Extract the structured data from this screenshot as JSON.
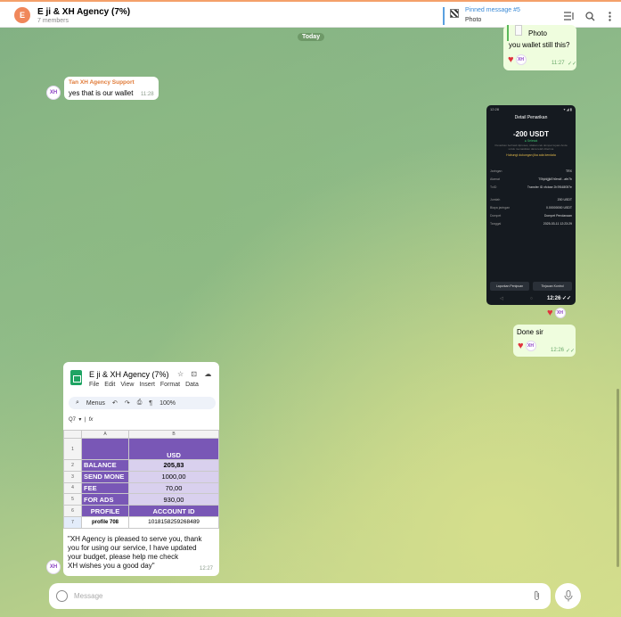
{
  "header": {
    "avatar_letter": "E",
    "title": "E ji & XH Agency (7%)",
    "members": "7 members",
    "pinned_title": "Pinned message #5",
    "pinned_sub": "Photo"
  },
  "chat": {
    "date_chip": "Today",
    "out_photo": {
      "caption_top": "Photo",
      "text": "you wallet still this?",
      "time": "11:27"
    },
    "in_reply": {
      "sender": "Tan XH Agency Support",
      "text": "yes that is our wallet",
      "time": "11:28"
    },
    "phone": {
      "status_left": "12:28",
      "status_right": "▾ ◢ ▮",
      "title": "Detail Penarikan",
      "amount": "-200 USDT",
      "status_ok": "● Selesai",
      "note": "Penarikan berhasil diproses, silakan cek dompet tujuan Anda untuk memastikan dana telah diterima",
      "link": "Hubungi dukungan jika ada kendala",
      "rows": [
        {
          "k": "Jaringan",
          "v": "TRX"
        },
        {
          "k": "Alamat",
          "v": "TSfyfdjjjkEh9mdf...afe7b"
        },
        {
          "k": "TxID",
          "v": "Transfer ID xfcbae 2b7f648f3f7e"
        },
        {
          "k": "Jumlah",
          "v": "200 USDT"
        },
        {
          "k": "Biaya jaringan",
          "v": "0.00000000 USDT"
        },
        {
          "k": "Dompet",
          "v": "Dompet Pendanaan"
        },
        {
          "k": "Tanggal",
          "v": "2025-03-11 12:23:29"
        }
      ],
      "btn_left": "Laporkan Penipuan",
      "btn_right": "Tinjauan Kontrol",
      "time": "12:26",
      "nav": [
        "◁",
        "○",
        "□"
      ]
    },
    "done": {
      "text": "Done sir",
      "time": "12:26"
    },
    "sheet": {
      "title": "E ji & XH Agency (7%)",
      "toolbar_icons": "☆ ⊡ ☁",
      "menu": [
        "File",
        "Edit",
        "View",
        "Insert",
        "Format",
        "Data"
      ],
      "tools_label": "Menus",
      "zoom": "100%",
      "cell_ref": "Q7",
      "fx": "fx",
      "col_headers": [
        "A",
        "B"
      ],
      "rows": [
        {
          "n": "1",
          "a": "",
          "b": "USD"
        },
        {
          "n": "2",
          "a": "BALANCE",
          "b": "205,83"
        },
        {
          "n": "3",
          "a": "SEND MONE",
          "b": "1000,00"
        },
        {
          "n": "4",
          "a": "FEE",
          "b": "70,00"
        },
        {
          "n": "5",
          "a": "FOR ADS",
          "b": "930,00"
        },
        {
          "n": "6",
          "a": "PROFILE",
          "b": "ACCOUNT ID"
        },
        {
          "n": "7",
          "a": "profile 708",
          "b": "1018158259268489"
        }
      ],
      "caption_1": "\"XH Agency is pleased to serve you, thank",
      "caption_2": "you for using our service, I have updated",
      "caption_3": "your budget, please help me check",
      "caption_4": "XH wishes you a good day\"",
      "time": "12:27"
    },
    "agency_avatar": "XH"
  },
  "composer": {
    "placeholder": "Message"
  },
  "colors": {
    "accent": "#f0875a",
    "sheet_purple": "#7957b6",
    "sheet_lavender": "#d9d0ee",
    "sender_name": "#e07b39"
  }
}
